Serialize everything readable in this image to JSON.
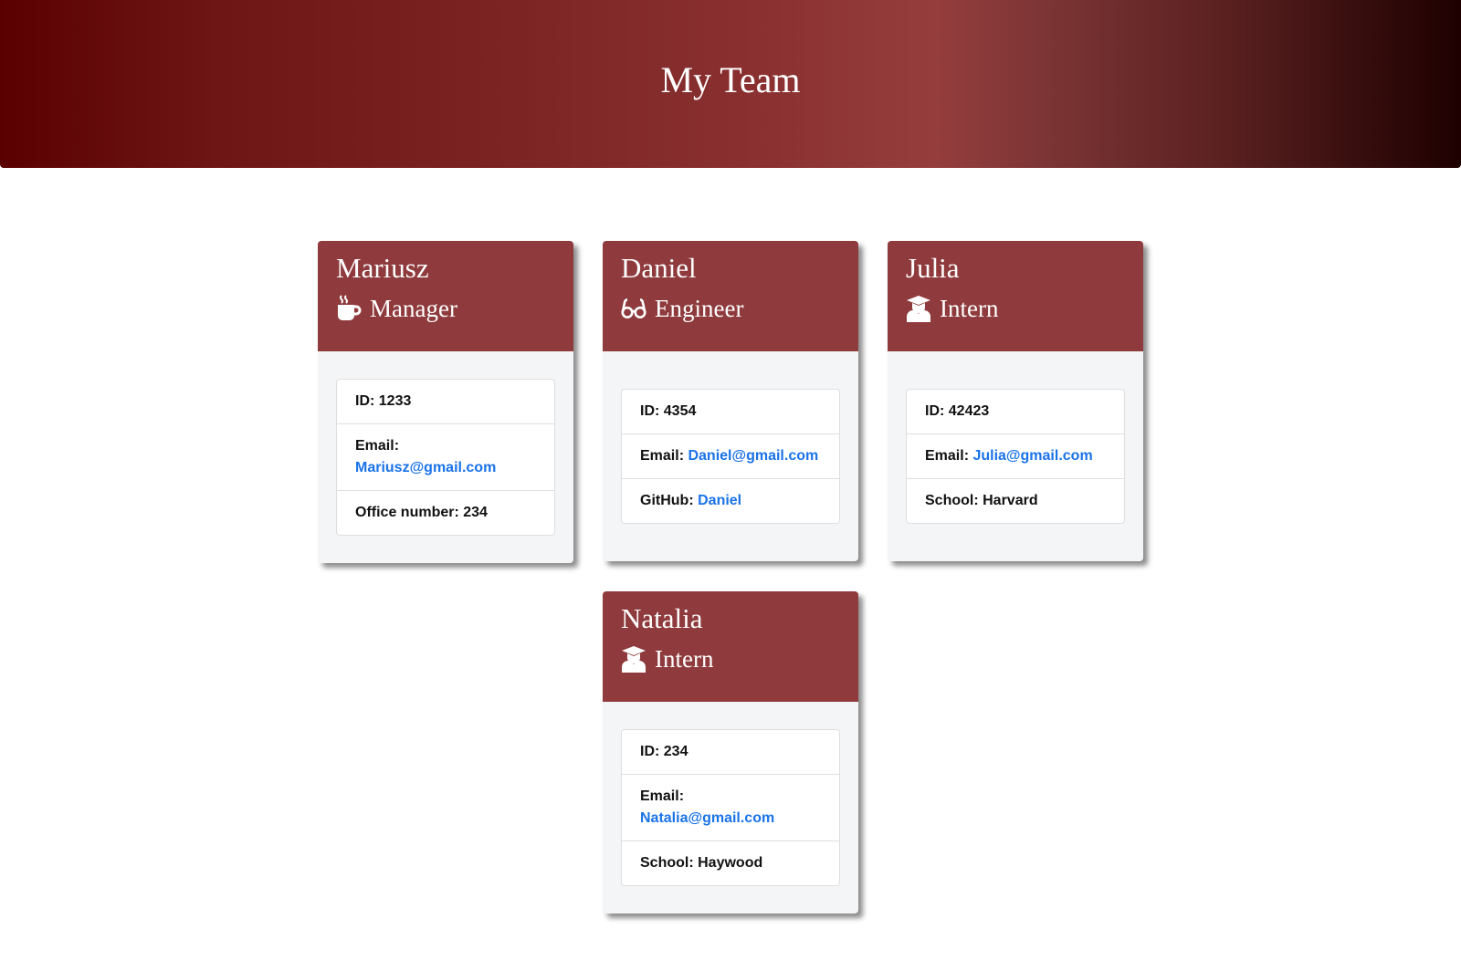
{
  "header": {
    "title": "My Team"
  },
  "colors": {
    "header_gradient_start": "#5a0000",
    "header_gradient_end": "#1e0000",
    "card_header": "#8f3a3c",
    "link": "#1a73e8"
  },
  "cards": [
    {
      "name": "Mariusz",
      "role": "Manager",
      "icon": "coffee-mug-icon",
      "id_label": "ID:",
      "id": "1233",
      "email_label": "Email:",
      "email": "Mariusz@gmail.com",
      "extra_label": "Office number:",
      "extra_value": "234"
    },
    {
      "name": "Daniel",
      "role": "Engineer",
      "icon": "glasses-icon",
      "id_label": "ID:",
      "id": "4354",
      "email_label": "Email:",
      "email": "Daniel@gmail.com",
      "extra_label": "GitHub:",
      "extra_value": "Daniel"
    },
    {
      "name": "Julia",
      "role": "Intern",
      "icon": "graduate-icon",
      "id_label": "ID:",
      "id": "42423",
      "email_label": "Email:",
      "email": "Julia@gmail.com",
      "extra_label": "School:",
      "extra_value": "Harvard"
    },
    {
      "name": "Natalia",
      "role": "Intern",
      "icon": "graduate-icon",
      "id_label": "ID:",
      "id": "234",
      "email_label": "Email:",
      "email": "Natalia@gmail.com",
      "extra_label": "School:",
      "extra_value": "Haywood"
    }
  ]
}
